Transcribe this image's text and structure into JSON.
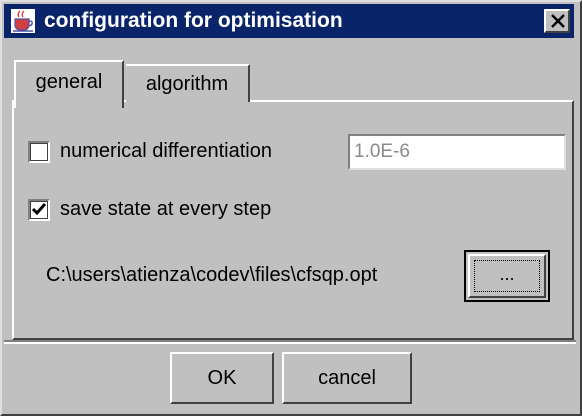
{
  "window": {
    "title": "configuration for optimisation",
    "icon": "java-cup-icon",
    "close_icon": "close-icon"
  },
  "tabs": [
    {
      "label": "general",
      "selected": true
    },
    {
      "label": "algorithm",
      "selected": false
    }
  ],
  "general": {
    "numerical_differentiation": {
      "label": "numerical differentiation",
      "checked": false,
      "value": "1.0E-6"
    },
    "save_state": {
      "label": "save state at every step",
      "checked": true
    },
    "file_path": "C:\\users\\atienza\\codev\\files\\cfsqp.opt",
    "browse_label": "..."
  },
  "buttons": {
    "ok": "OK",
    "cancel": "cancel"
  },
  "colors": {
    "title_bar": "#0a246a",
    "face": "#c0c0c0"
  }
}
